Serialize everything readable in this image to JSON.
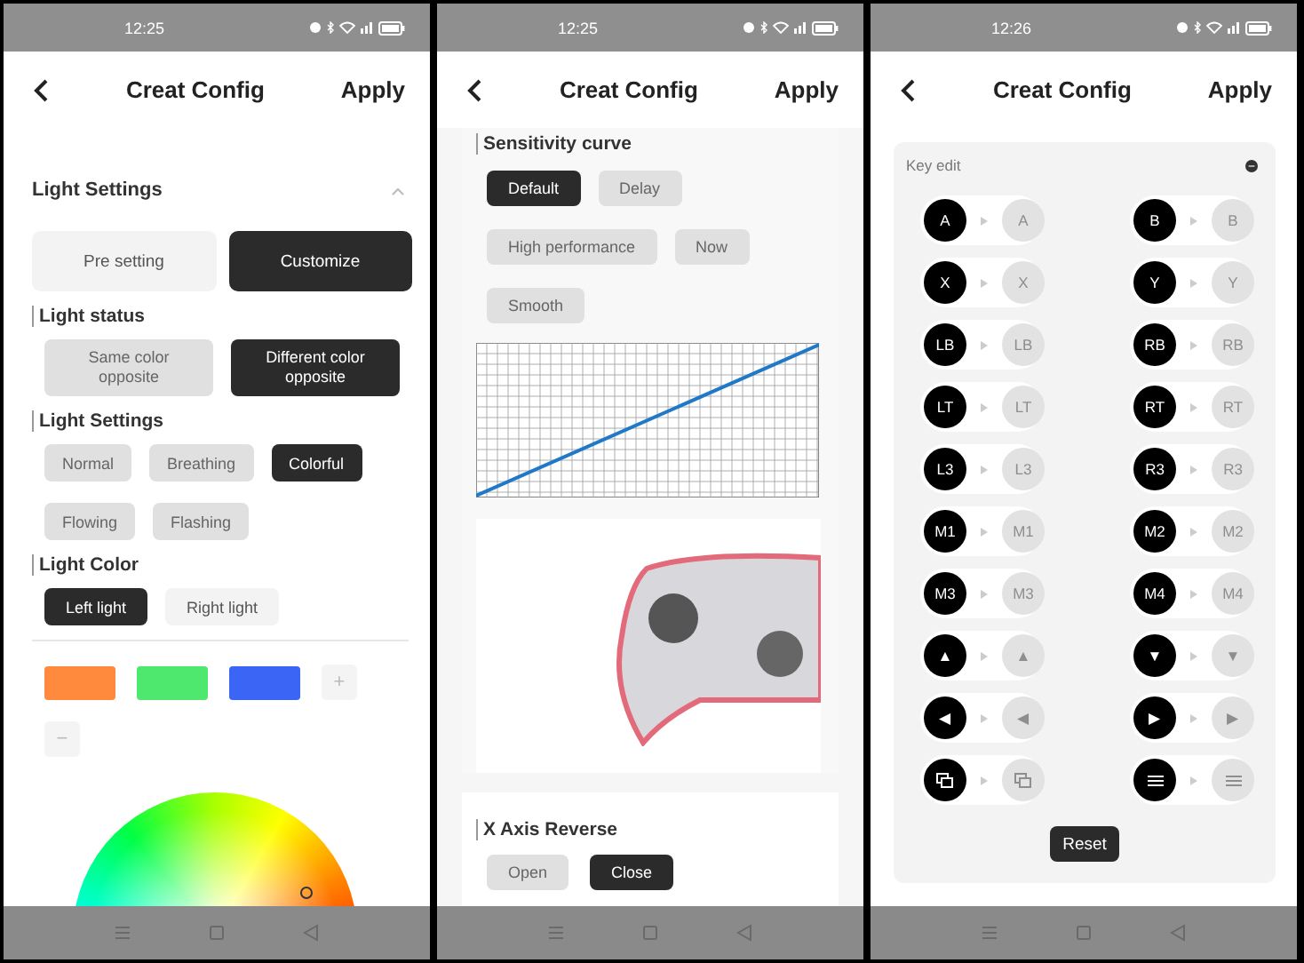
{
  "screens": [
    {
      "kind": "light",
      "status_time": "12:25",
      "header": {
        "title": "Creat Config",
        "action": "Apply"
      },
      "panel": {
        "title": "Light Settings",
        "expanded": true,
        "modes": [
          {
            "label": "Pre setting",
            "selected": false
          },
          {
            "label": "Customize",
            "selected": true
          }
        ],
        "groups": [
          {
            "kind": "pair",
            "title": "Light status",
            "options": [
              {
                "label": "Same color opposite",
                "selected": false
              },
              {
                "label": "Different color opposite",
                "selected": true
              }
            ]
          },
          {
            "kind": "chips",
            "title": "Light Settings",
            "options": [
              {
                "label": "Normal",
                "selected": false
              },
              {
                "label": "Breathing",
                "selected": false
              },
              {
                "label": "Colorful",
                "selected": true
              },
              {
                "label": "Flowing",
                "selected": false
              },
              {
                "label": "Flashing",
                "selected": false
              }
            ]
          },
          {
            "kind": "tabs",
            "title": "Light Color",
            "options": [
              {
                "label": "Left light",
                "selected": true
              },
              {
                "label": "Right light",
                "selected": false
              }
            ]
          }
        ],
        "swatches": [
          {
            "color": "#ff8a3d"
          },
          {
            "color": "#4ee86e"
          },
          {
            "color": "#3b66f5"
          }
        ],
        "add": "+",
        "remove": "−"
      }
    },
    {
      "kind": "sensitivity",
      "status_time": "12:25",
      "header": {
        "title": "Creat Config",
        "action": "Apply"
      },
      "curve": {
        "title": "Sensitivity curve",
        "options": [
          {
            "label": "Default",
            "selected": true
          },
          {
            "label": "Delay",
            "selected": false
          },
          {
            "label": "High performance",
            "selected": false
          },
          {
            "label": "Now",
            "selected": false
          },
          {
            "label": "Smooth",
            "selected": false
          }
        ]
      },
      "reverse": {
        "title": "X Axis Reverse",
        "options": [
          {
            "label": "Open",
            "selected": false
          },
          {
            "label": "Close",
            "selected": true
          }
        ]
      }
    },
    {
      "kind": "keys",
      "status_time": "12:26",
      "header": {
        "title": "Creat Config",
        "action": "Apply"
      },
      "key_edit": {
        "title": "Key edit",
        "keys": [
          {
            "kind": "text",
            "source": "A",
            "target": "A"
          },
          {
            "kind": "text",
            "source": "B",
            "target": "B"
          },
          {
            "kind": "text",
            "source": "X",
            "target": "X"
          },
          {
            "kind": "text",
            "source": "Y",
            "target": "Y"
          },
          {
            "kind": "text",
            "source": "LB",
            "target": "LB"
          },
          {
            "kind": "text",
            "source": "RB",
            "target": "RB"
          },
          {
            "kind": "text",
            "source": "LT",
            "target": "LT"
          },
          {
            "kind": "text",
            "source": "RT",
            "target": "RT"
          },
          {
            "kind": "text",
            "source": "L3",
            "target": "L3"
          },
          {
            "kind": "text",
            "source": "R3",
            "target": "R3"
          },
          {
            "kind": "text",
            "source": "M1",
            "target": "M1"
          },
          {
            "kind": "text",
            "source": "M2",
            "target": "M2"
          },
          {
            "kind": "text",
            "source": "M3",
            "target": "M3"
          },
          {
            "kind": "text",
            "source": "M4",
            "target": "M4"
          },
          {
            "kind": "text",
            "source": "▲",
            "target": "▲"
          },
          {
            "kind": "text",
            "source": "▼",
            "target": "▼"
          },
          {
            "kind": "text",
            "source": "◀",
            "target": "◀"
          },
          {
            "kind": "text",
            "source": "▶",
            "target": "▶"
          },
          {
            "kind": "view"
          },
          {
            "kind": "menu"
          }
        ],
        "reset": "Reset"
      }
    }
  ]
}
